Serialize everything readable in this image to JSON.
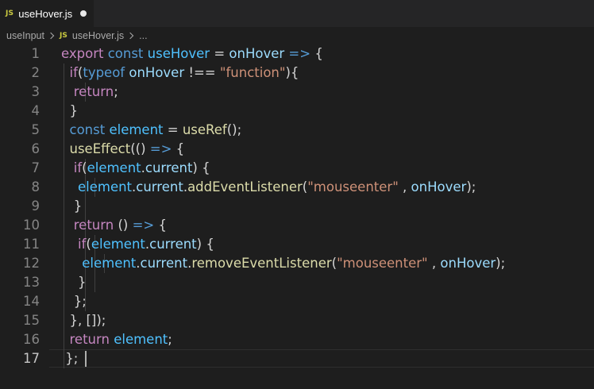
{
  "tab": {
    "icon_label": "JS",
    "filename": "useHover.js"
  },
  "breadcrumb": {
    "folder": "useInput",
    "js_icon_label": "JS",
    "file": "useHover.js",
    "ellipsis": "..."
  },
  "editor": {
    "line_numbers": [
      "1",
      "2",
      "3",
      "4",
      "5",
      "6",
      "7",
      "8",
      "9",
      "10",
      "11",
      "12",
      "13",
      "14",
      "15",
      "16",
      "17"
    ],
    "active_line": "17",
    "colors": {
      "keyword": "#569cd6",
      "control": "#c586c0",
      "function": "#dcdcaa",
      "variable": "#9cdcfe",
      "constant": "#4fc1ff",
      "string": "#ce9178",
      "text": "#d4d4d4"
    },
    "lines": [
      [
        [
          "export",
          "ctl"
        ],
        [
          " ",
          "op"
        ],
        [
          "const",
          "kw"
        ],
        [
          " ",
          "op"
        ],
        [
          "useHover",
          "cn"
        ],
        [
          " = ",
          "op"
        ],
        [
          "onHover",
          "vr"
        ],
        [
          " ",
          "op"
        ],
        [
          "=>",
          "kw"
        ],
        [
          " {",
          "op"
        ]
      ],
      [
        [
          "  ",
          "op"
        ],
        [
          "if",
          "ctl"
        ],
        [
          "(",
          "op"
        ],
        [
          "typeof",
          "kw"
        ],
        [
          " ",
          "op"
        ],
        [
          "onHover",
          "vr"
        ],
        [
          " !== ",
          "op"
        ],
        [
          "\"function\"",
          "st"
        ],
        [
          "){",
          "op"
        ]
      ],
      [
        [
          "   ",
          "op"
        ],
        [
          "return",
          "ctl"
        ],
        [
          ";",
          "op"
        ]
      ],
      [
        [
          "  }",
          "op"
        ]
      ],
      [
        [
          "  ",
          "op"
        ],
        [
          "const",
          "kw"
        ],
        [
          " ",
          "op"
        ],
        [
          "element",
          "cn"
        ],
        [
          " = ",
          "op"
        ],
        [
          "useRef",
          "fn"
        ],
        [
          "();",
          "op"
        ]
      ],
      [
        [
          "  ",
          "op"
        ],
        [
          "useEffect",
          "fn"
        ],
        [
          "(() ",
          "op"
        ],
        [
          "=>",
          "kw"
        ],
        [
          " {",
          "op"
        ]
      ],
      [
        [
          "   ",
          "op"
        ],
        [
          "if",
          "ctl"
        ],
        [
          "(",
          "op"
        ],
        [
          "element",
          "cn"
        ],
        [
          ".",
          "op"
        ],
        [
          "current",
          "vr"
        ],
        [
          ") {",
          "op"
        ]
      ],
      [
        [
          "    ",
          "op"
        ],
        [
          "element",
          "cn"
        ],
        [
          ".",
          "op"
        ],
        [
          "current",
          "vr"
        ],
        [
          ".",
          "op"
        ],
        [
          "addEventListener",
          "fn"
        ],
        [
          "(",
          "op"
        ],
        [
          "\"mouseenter\"",
          "st"
        ],
        [
          " , ",
          "op"
        ],
        [
          "onHover",
          "vr"
        ],
        [
          ");",
          "op"
        ]
      ],
      [
        [
          "   }",
          "op"
        ]
      ],
      [
        [
          "   ",
          "op"
        ],
        [
          "return",
          "ctl"
        ],
        [
          " () ",
          "op"
        ],
        [
          "=>",
          "kw"
        ],
        [
          " {",
          "op"
        ]
      ],
      [
        [
          "    ",
          "op"
        ],
        [
          "if",
          "ctl"
        ],
        [
          "(",
          "op"
        ],
        [
          "element",
          "cn"
        ],
        [
          ".",
          "op"
        ],
        [
          "current",
          "vr"
        ],
        [
          ") {",
          "op"
        ]
      ],
      [
        [
          "     ",
          "op"
        ],
        [
          "element",
          "cn"
        ],
        [
          ".",
          "op"
        ],
        [
          "current",
          "vr"
        ],
        [
          ".",
          "op"
        ],
        [
          "removeEventListener",
          "fn"
        ],
        [
          "(",
          "op"
        ],
        [
          "\"mouseenter\"",
          "st"
        ],
        [
          " , ",
          "op"
        ],
        [
          "onHover",
          "vr"
        ],
        [
          ");",
          "op"
        ]
      ],
      [
        [
          "    }",
          "op"
        ]
      ],
      [
        [
          "   };",
          "op"
        ]
      ],
      [
        [
          "  }, []);",
          "op"
        ]
      ],
      [
        [
          "  ",
          "op"
        ],
        [
          "return",
          "ctl"
        ],
        [
          " ",
          "op"
        ],
        [
          "element",
          "cn"
        ],
        [
          ";",
          "op"
        ]
      ],
      [
        [
          " };",
          "op"
        ]
      ]
    ]
  }
}
